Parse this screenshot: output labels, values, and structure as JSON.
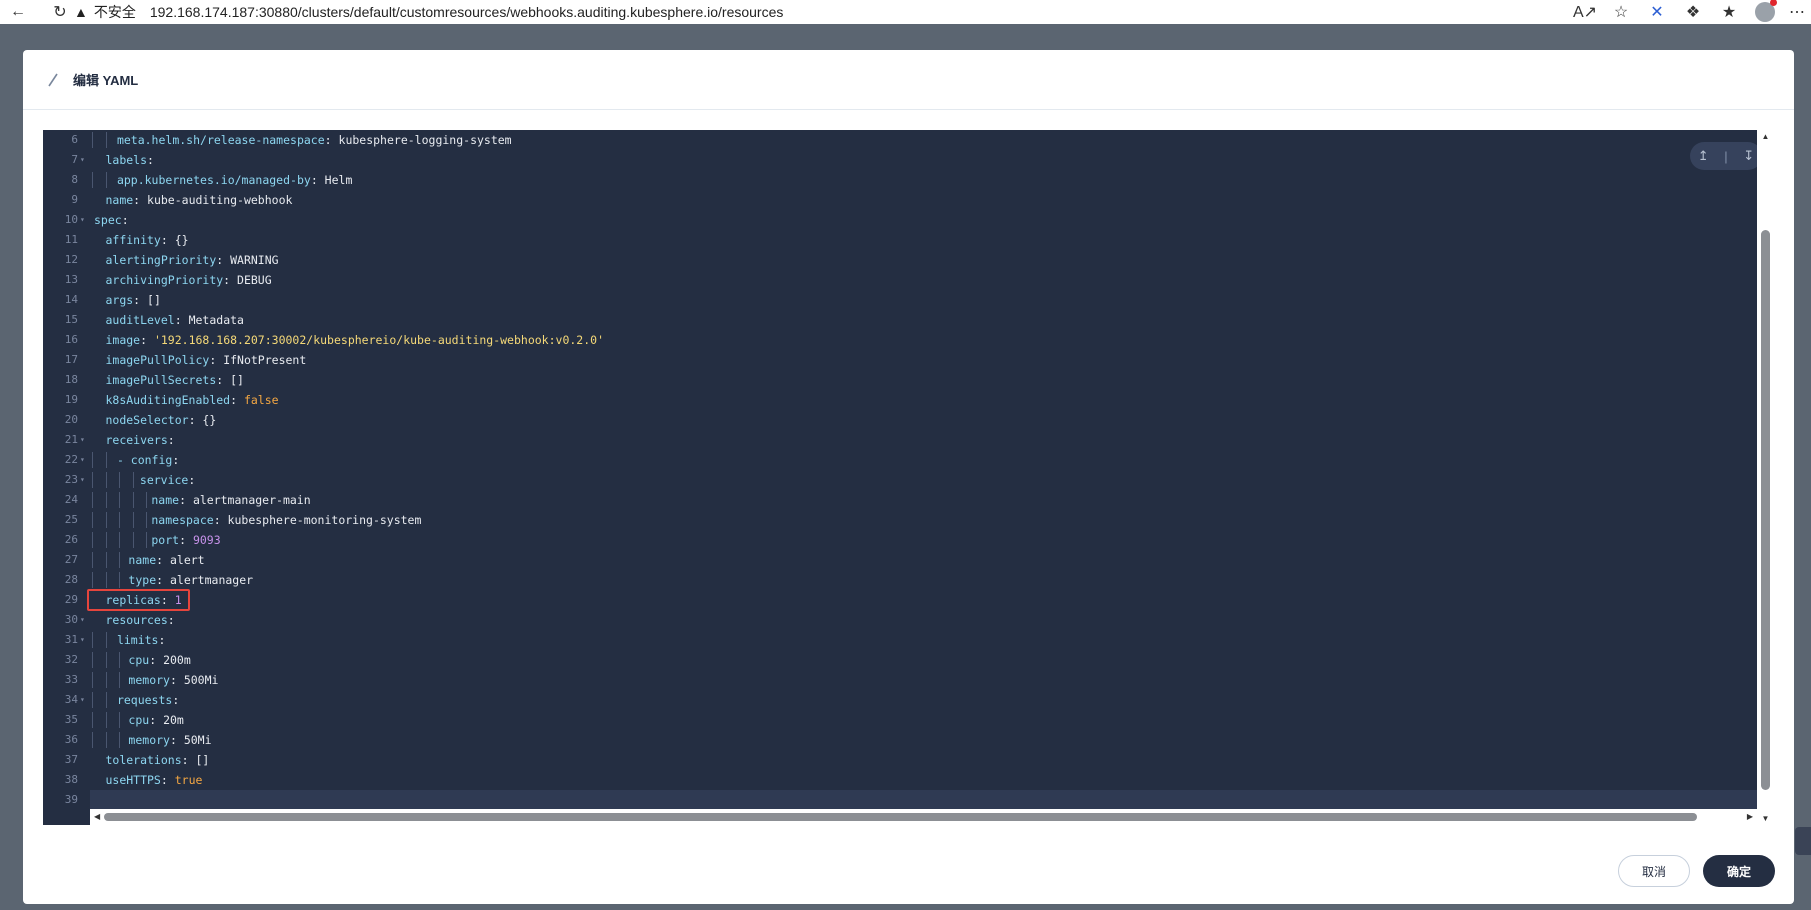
{
  "browser": {
    "warning_label": "不安全",
    "url": "192.168.174.187:30880/clusters/default/customresources/webhooks.auditing.kubesphere.io/resources"
  },
  "modal": {
    "title": "编辑 YAML",
    "cancel_label": "取消",
    "confirm_label": "确定"
  },
  "editor": {
    "lines": [
      {
        "n": "6",
        "fold": false,
        "indent": 2,
        "key": "meta.helm.sh/release-namespace",
        "value": "kubesphere-logging-system",
        "vtype": "plain"
      },
      {
        "n": "7",
        "fold": true,
        "indent": 1,
        "key": "labels",
        "value": "",
        "vtype": "plain"
      },
      {
        "n": "8",
        "fold": false,
        "indent": 2,
        "key": "app.kubernetes.io/managed-by",
        "value": "Helm",
        "vtype": "plain"
      },
      {
        "n": "9",
        "fold": false,
        "indent": 1,
        "key": "name",
        "value": "kube-auditing-webhook",
        "vtype": "plain"
      },
      {
        "n": "10",
        "fold": true,
        "indent": 0,
        "key": "spec",
        "value": "",
        "vtype": "plain"
      },
      {
        "n": "11",
        "fold": false,
        "indent": 1,
        "key": "affinity",
        "value": "{}",
        "vtype": "plain"
      },
      {
        "n": "12",
        "fold": false,
        "indent": 1,
        "key": "alertingPriority",
        "value": "WARNING",
        "vtype": "plain"
      },
      {
        "n": "13",
        "fold": false,
        "indent": 1,
        "key": "archivingPriority",
        "value": "DEBUG",
        "vtype": "plain"
      },
      {
        "n": "14",
        "fold": false,
        "indent": 1,
        "key": "args",
        "value": "[]",
        "vtype": "plain"
      },
      {
        "n": "15",
        "fold": false,
        "indent": 1,
        "key": "auditLevel",
        "value": "Metadata",
        "vtype": "plain"
      },
      {
        "n": "16",
        "fold": false,
        "indent": 1,
        "key": "image",
        "value": "'192.168.168.207:30002/kubesphereio/kube-auditing-webhook:v0.2.0'",
        "vtype": "str"
      },
      {
        "n": "17",
        "fold": false,
        "indent": 1,
        "key": "imagePullPolicy",
        "value": "IfNotPresent",
        "vtype": "plain"
      },
      {
        "n": "18",
        "fold": false,
        "indent": 1,
        "key": "imagePullSecrets",
        "value": "[]",
        "vtype": "plain"
      },
      {
        "n": "19",
        "fold": false,
        "indent": 1,
        "key": "k8sAuditingEnabled",
        "value": "false",
        "vtype": "bool"
      },
      {
        "n": "20",
        "fold": false,
        "indent": 1,
        "key": "nodeSelector",
        "value": "{}",
        "vtype": "plain"
      },
      {
        "n": "21",
        "fold": true,
        "indent": 1,
        "key": "receivers",
        "value": "",
        "vtype": "plain"
      },
      {
        "n": "22",
        "fold": true,
        "indent": 2,
        "key": "- config",
        "value": "",
        "vtype": "plain"
      },
      {
        "n": "23",
        "fold": true,
        "indent": 4,
        "key": "service",
        "value": "",
        "vtype": "plain"
      },
      {
        "n": "24",
        "fold": false,
        "indent": 5,
        "key": "name",
        "value": "alertmanager-main",
        "vtype": "plain"
      },
      {
        "n": "25",
        "fold": false,
        "indent": 5,
        "key": "namespace",
        "value": "kubesphere-monitoring-system",
        "vtype": "plain"
      },
      {
        "n": "26",
        "fold": false,
        "indent": 5,
        "key": "port",
        "value": "9093",
        "vtype": "num"
      },
      {
        "n": "27",
        "fold": false,
        "indent": 3,
        "key": "name",
        "value": "alert",
        "vtype": "plain"
      },
      {
        "n": "28",
        "fold": false,
        "indent": 3,
        "key": "type",
        "value": "alertmanager",
        "vtype": "plain"
      },
      {
        "n": "29",
        "fold": false,
        "indent": 1,
        "key": "replicas",
        "value": "1",
        "vtype": "num",
        "highlight": true
      },
      {
        "n": "30",
        "fold": true,
        "indent": 1,
        "key": "resources",
        "value": "",
        "vtype": "plain"
      },
      {
        "n": "31",
        "fold": true,
        "indent": 2,
        "key": "limits",
        "value": "",
        "vtype": "plain"
      },
      {
        "n": "32",
        "fold": false,
        "indent": 3,
        "key": "cpu",
        "value": "200m",
        "vtype": "plain"
      },
      {
        "n": "33",
        "fold": false,
        "indent": 3,
        "key": "memory",
        "value": "500Mi",
        "vtype": "plain"
      },
      {
        "n": "34",
        "fold": true,
        "indent": 2,
        "key": "requests",
        "value": "",
        "vtype": "plain"
      },
      {
        "n": "35",
        "fold": false,
        "indent": 3,
        "key": "cpu",
        "value": "20m",
        "vtype": "plain"
      },
      {
        "n": "36",
        "fold": false,
        "indent": 3,
        "key": "memory",
        "value": "50Mi",
        "vtype": "plain"
      },
      {
        "n": "37",
        "fold": false,
        "indent": 1,
        "key": "tolerations",
        "value": "[]",
        "vtype": "plain"
      },
      {
        "n": "38",
        "fold": false,
        "indent": 1,
        "key": "useHTTPS",
        "value": "true",
        "vtype": "bool"
      },
      {
        "n": "39",
        "fold": false,
        "indent": 0,
        "key": "",
        "value": "",
        "vtype": "plain",
        "active": true
      }
    ]
  }
}
